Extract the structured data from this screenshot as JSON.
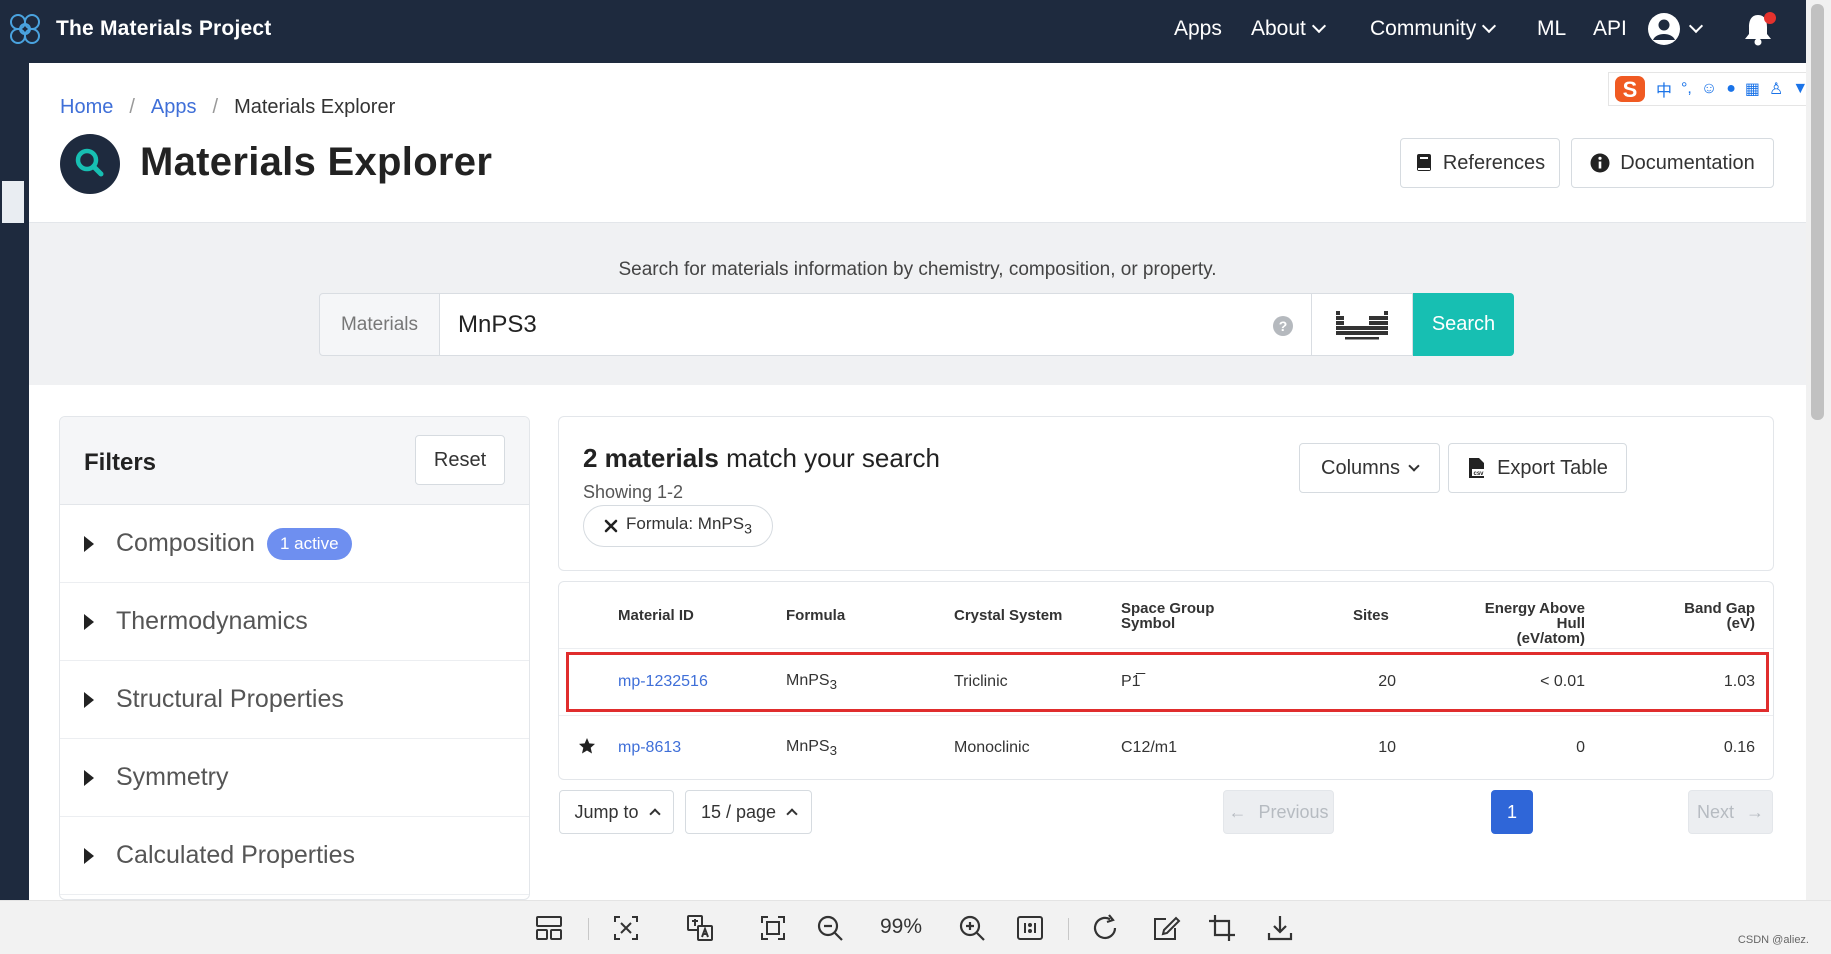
{
  "navbar": {
    "brand": "The Materials Project",
    "links": [
      {
        "label": "Apps",
        "has_menu": false
      },
      {
        "label": "About",
        "has_menu": true
      },
      {
        "label": "Community",
        "has_menu": true
      },
      {
        "label": "ML",
        "has_menu": false
      },
      {
        "label": "API",
        "has_menu": false
      }
    ],
    "icons": [
      "atom-logo-icon",
      "user-account-icon",
      "notification-bell-icon"
    ]
  },
  "breadcrumb": {
    "home": "Home",
    "sep": "/",
    "apps": "Apps",
    "current": "Materials Explorer"
  },
  "page": {
    "title": "Materials Explorer",
    "title_icon": "search-icon",
    "references_label": "References",
    "documentation_label": "Documentation"
  },
  "search": {
    "prompt": "Search for materials information by chemistry, composition, or property.",
    "field_label": "Materials",
    "value": "MnPS3",
    "help_icon": "?",
    "button_label": "Search"
  },
  "filters": {
    "title": "Filters",
    "reset_label": "Reset",
    "items": [
      {
        "label": "Composition",
        "badge": "1 active"
      },
      {
        "label": "Thermodynamics"
      },
      {
        "label": "Structural Properties"
      },
      {
        "label": "Symmetry"
      },
      {
        "label": "Calculated Properties"
      }
    ]
  },
  "results": {
    "count_bold": "2 materials",
    "count_rest": "match your search",
    "showing": "Showing 1-2",
    "chip_label": "Formula: MnPS",
    "chip_sub": "3",
    "columns_label": "Columns",
    "export_label": "Export Table"
  },
  "table": {
    "headers": {
      "material_id": "Material ID",
      "formula": "Formula",
      "crystal_system": "Crystal System",
      "space_group_1": "Space Group",
      "space_group_2": "Symbol",
      "sites": "Sites",
      "ehull_1": "Energy Above Hull",
      "ehull_2": "(eV/atom)",
      "bandgap_1": "Band Gap",
      "bandgap_2": "(eV)"
    },
    "rows": [
      {
        "starred": false,
        "id": "mp-1232516",
        "formula": "MnPS",
        "formula_sub": "3",
        "crystal": "Triclinic",
        "spacegroup": "P1̅",
        "sites": "20",
        "ehull": "< 0.01",
        "bandgap": "1.03",
        "highlighted": true
      },
      {
        "starred": true,
        "id": "mp-8613",
        "formula": "MnPS",
        "formula_sub": "3",
        "crystal": "Monoclinic",
        "spacegroup": "C12/m1",
        "sites": "10",
        "ehull": "0",
        "bandgap": "0.16",
        "highlighted": false
      }
    ]
  },
  "pagination": {
    "jump_label": "Jump to",
    "per_page_label": "15 / page",
    "previous_label": "Previous",
    "current_page": "1",
    "next_label": "Next"
  },
  "viewer": {
    "zoom": "99%",
    "watermark": "CSDN @aliez."
  },
  "ime": {
    "mode": "中",
    "punct": "°,"
  },
  "colors": {
    "navbar_bg": "#1e2a3e",
    "accent_teal": "#17bfb2",
    "link_blue": "#3f6fd8",
    "badge_blue": "#6e8ff0",
    "highlight_red": "#e02d2d",
    "page_blue": "#2f66d8"
  }
}
